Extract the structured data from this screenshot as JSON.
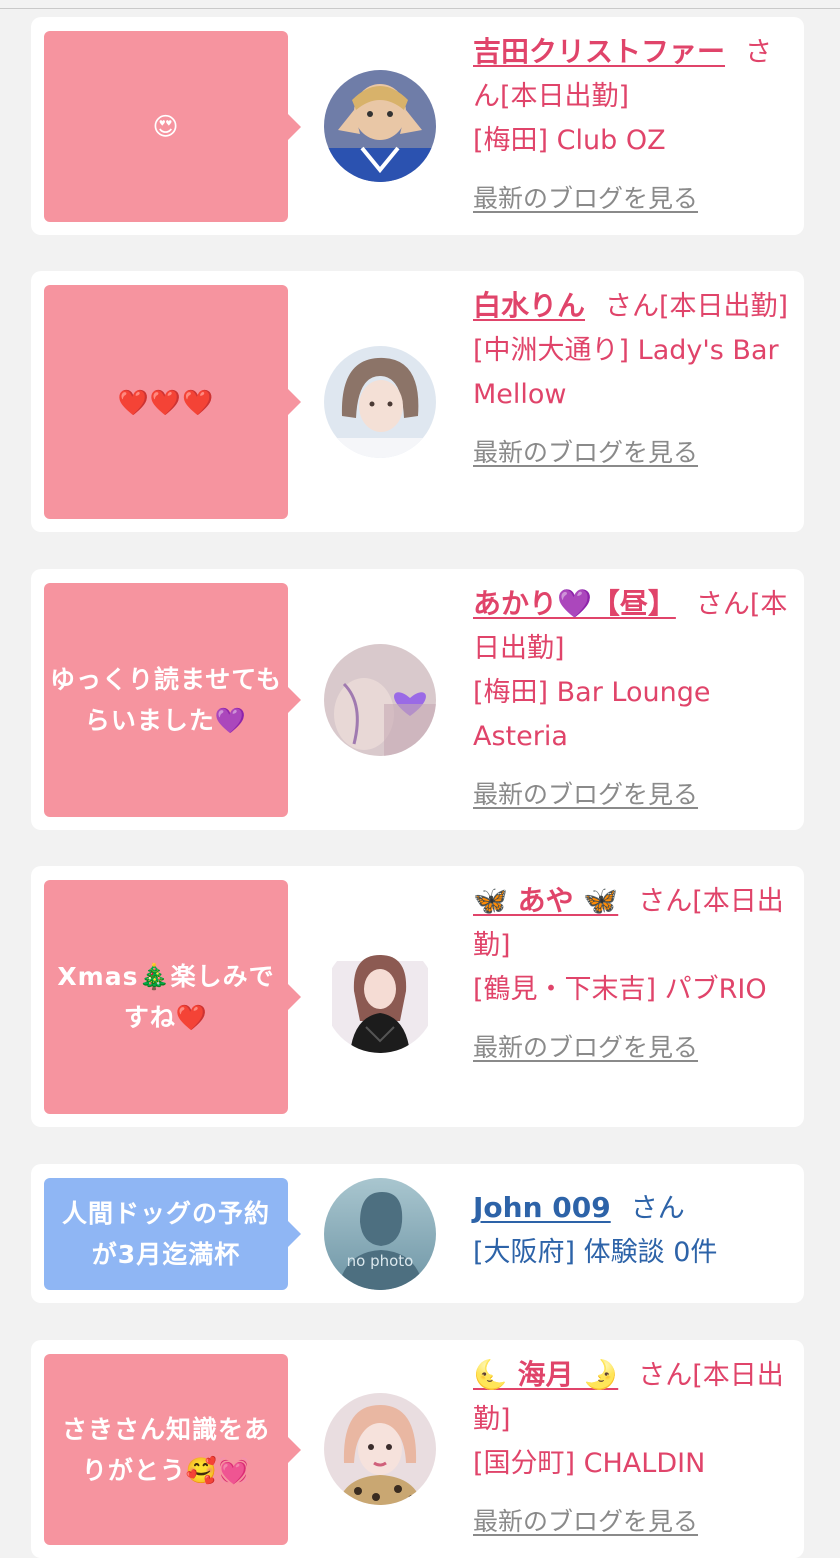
{
  "colors": {
    "pink": "#f6949f",
    "blue": "#8fb6f4",
    "name_pink": "#e0446a",
    "name_blue": "#2d63a8",
    "link_gray": "#8a8a8a"
  },
  "entries": [
    {
      "comment": "😍",
      "name": "吉田クリストファー",
      "san_status": "さん[本日出勤]",
      "area_shop": "[梅田] Club OZ",
      "blog_link": "最新のブログを見る"
    },
    {
      "comment": "❤️❤️❤️",
      "name": "白水りん",
      "san_status": "さん[本日出勤]",
      "area_shop": "[中洲大通り] Lady's Bar Mellow",
      "blog_link": "最新のブログを見る"
    },
    {
      "comment": "ゆっくり読ませてもらいました💜",
      "name": "あかり💜【昼】",
      "san_status": "さん[本日出勤]",
      "area_shop": "[梅田] Bar Lounge Asteria",
      "blog_link": "最新のブログを見る"
    },
    {
      "comment": "Xmas🎄楽しみですね❤️",
      "name": "🦋 あや 🦋",
      "san_status": "さん[本日出勤]",
      "area_shop": "[鶴見・下末吉] パブRIO",
      "blog_link": "最新のブログを見る"
    },
    {
      "comment": "人間ドッグの予約が3月迄満杯",
      "name": "John 009",
      "san_status": "さん",
      "area_shop": "[大阪府] 体験談 0件",
      "avatar_text": "no photo"
    },
    {
      "comment": "さきさん知識をありがとう🥰💓",
      "name": "🌜 海月 🌛",
      "san_status": "さん[本日出勤]",
      "area_shop": "[国分町] CHALDIN",
      "blog_link": "最新のブログを見る"
    }
  ]
}
